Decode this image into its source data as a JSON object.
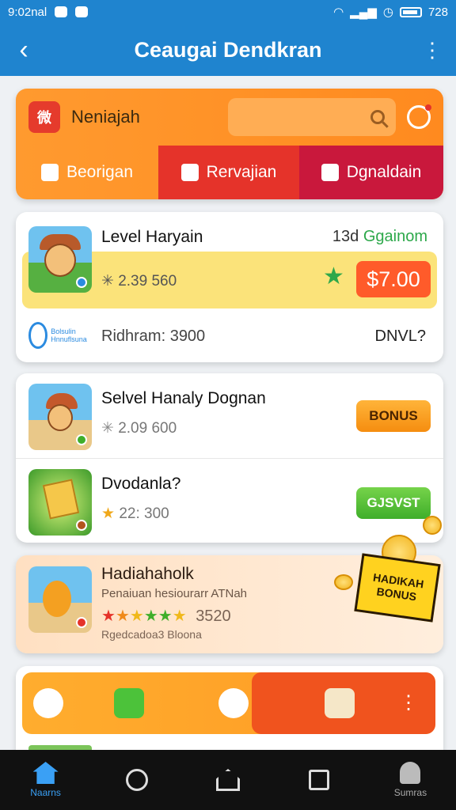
{
  "status_bar": {
    "time": "9:02nal",
    "battery_pct": "728"
  },
  "appbar": {
    "back_icon": "arrow-left-icon",
    "title": "Ceaugai Dendkran",
    "menu_icon": "kebab-icon"
  },
  "top_card": {
    "label": "Neniajah",
    "search_icon": "search-icon",
    "notification_icon": "target-icon",
    "tabs": [
      {
        "label": "Beorigan",
        "icon": "home-icon"
      },
      {
        "label": "Rervajian",
        "icon": "monitor-icon"
      },
      {
        "label": "Dgnaldain",
        "icon": "group-icon"
      }
    ]
  },
  "games": [
    {
      "title": "Level Haryain",
      "meta_number": "13d",
      "meta_green": "Ggainom",
      "count": "2.39 560",
      "count_prefix": "✳",
      "price": "$7.00",
      "footer_label": "Ridhram: 3900",
      "footer_right": "DNVL?",
      "footer_logo_text": "Bolsulin Hnnuflsuna"
    },
    {
      "title": "Selvel Hanaly Dognan",
      "count": "2.09 600",
      "count_prefix": "✳",
      "button": "BONUS"
    },
    {
      "title": "Dvodanla?",
      "count": "22: 300",
      "count_prefix": "★",
      "button": "GJSVST"
    }
  ],
  "promo": {
    "title": "Hadiahaholk",
    "subtitle": "Penaiuan hesiourarr ATNah",
    "rating": "3520",
    "footer": "Rgedcadoa3 Bloona",
    "box_text": "HADIKAH BONUS"
  },
  "bottom_nav": [
    {
      "label": "Naarns",
      "icon": "home-icon",
      "active": true
    },
    {
      "label": "",
      "icon": "search-icon",
      "active": false
    },
    {
      "label": "",
      "icon": "house-outline-icon",
      "active": false
    },
    {
      "label": "",
      "icon": "square-icon",
      "active": false
    },
    {
      "label": "Sumras",
      "icon": "user-icon",
      "active": false
    }
  ],
  "colors": {
    "primary": "#1f84cf",
    "orange": "#ff9a2f",
    "red": "#e5332a",
    "green": "#2ca84a"
  }
}
